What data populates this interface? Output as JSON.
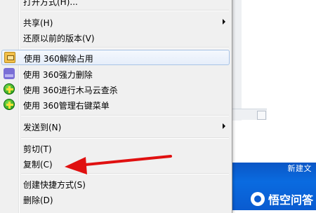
{
  "menu": {
    "partial_top_label": "打开方式(H)...",
    "items": [
      {
        "label": "共享(H)",
        "submenu": true
      },
      {
        "label": "还原以前的版本(V)",
        "submenu": false
      },
      {
        "label": "使用 360解除占用",
        "icon": "unlock-file-icon",
        "hover": true
      },
      {
        "label": "使用 360强力删除",
        "icon": "shred-file-icon"
      },
      {
        "label": "使用 360进行木马云查杀",
        "icon": "360-shield-icon"
      },
      {
        "label": "使用 360管理右键菜单",
        "icon": "360-shield-icon"
      },
      {
        "label": "发送到(N)",
        "submenu": true
      },
      {
        "label": "剪切(T)"
      },
      {
        "label": "复制(C)"
      },
      {
        "label": "创建快捷方式(S)"
      },
      {
        "label": "删除(D)"
      }
    ]
  },
  "background": {
    "desktop_label": "新建文",
    "watermark": "悟空问答"
  },
  "colors": {
    "menu_bg": "#f0f0f0",
    "hover_border": "#a8c3e6",
    "annotation_red": "#e01010",
    "desktop_blue": "#0a5bd0"
  }
}
